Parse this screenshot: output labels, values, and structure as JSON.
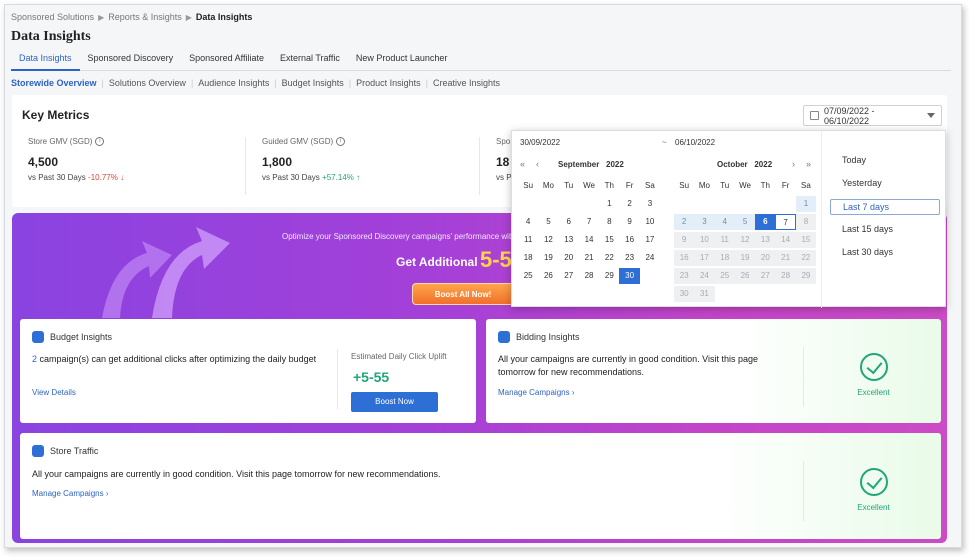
{
  "breadcrumb": [
    "Sponsored Solutions",
    "Reports & Insights",
    "Data Insights"
  ],
  "page_title": "Data Insights",
  "tabs": [
    "Data Insights",
    "Sponsored Discovery",
    "Sponsored Affiliate",
    "External Traffic",
    "New Product Launcher"
  ],
  "subtabs": [
    "Storewide Overview",
    "Solutions Overview",
    "Audience Insights",
    "Budget Insights",
    "Product Insights",
    "Creative Insights"
  ],
  "key_metrics": {
    "title": "Key Metrics",
    "date_range": "07/09/2022 - 06/10/2022",
    "items": [
      {
        "label": "Store GMV (SGD)",
        "value": "4,500",
        "vs": "vs Past 30 Days",
        "change": "-10.77% ↓"
      },
      {
        "label": "Guided GMV (SGD)",
        "value": "1,800",
        "vs": "vs Past 30 Days",
        "change": "+57.14% ↑"
      },
      {
        "label": "Spo",
        "value": "18",
        "vs": "vs P",
        "change": ""
      }
    ]
  },
  "promo": {
    "subtitle": "Optimize your Sponsored Discovery campaigns' performance with",
    "get": "Get Additional",
    "big": "5-5",
    "button": "Boost All Now!"
  },
  "budget_insights": {
    "title": "Budget Insights",
    "count": "2",
    "text": " campaign(s) can get additional clicks after optimizing the daily budget",
    "link": "View Details",
    "est_label": "Estimated Daily Click Uplift",
    "est_value": "+5-55",
    "button": "Boost Now"
  },
  "bidding_insights": {
    "title": "Bidding Insights",
    "text": "All your campaigns are currently in good condition. Visit this page tomorrow for new recommendations.",
    "link": "Manage Campaigns",
    "status": "Excellent"
  },
  "store_traffic": {
    "title": "Store Traffic",
    "text": "All your campaigns are currently in good condition. Visit this page tomorrow for new recommendations.",
    "link": "Manage Campaigns",
    "status": "Excellent"
  },
  "calendar": {
    "start_input": "30/09/2022",
    "tilde": "~",
    "end_input": "06/10/2022",
    "weekdays": [
      "Su",
      "Mo",
      "Tu",
      "We",
      "Th",
      "Fr",
      "Sa"
    ],
    "left": {
      "month": "September",
      "year": "2022",
      "first_weekday": 4,
      "days": 30
    },
    "right": {
      "month": "October",
      "year": "2022",
      "first_weekday": 6,
      "days": 31
    },
    "quick": [
      "Today",
      "Yesterday",
      "Last 7 days",
      "Last 15 days",
      "Last 30 days"
    ],
    "quick_active": "Last 7 days"
  }
}
